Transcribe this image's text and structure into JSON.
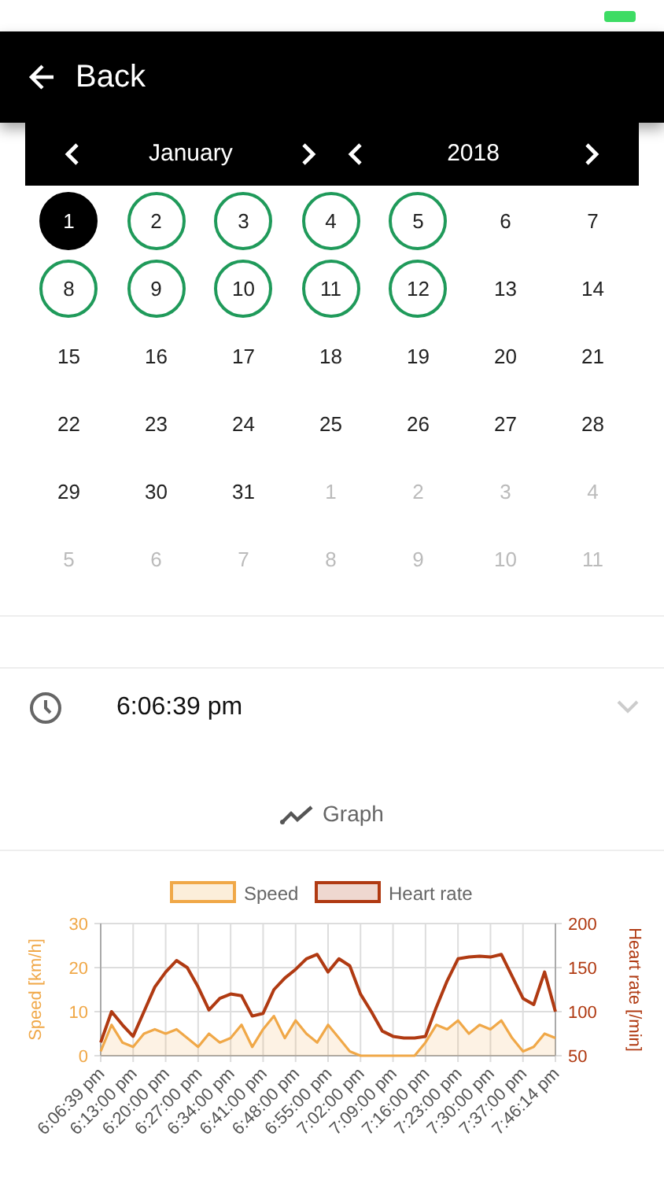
{
  "header": {
    "back_label": "Back"
  },
  "calendar": {
    "month": "January",
    "year": "2018",
    "weeks": [
      [
        {
          "label": "1",
          "selected": true,
          "marked": false,
          "outside": false
        },
        {
          "label": "2",
          "selected": false,
          "marked": true,
          "outside": false
        },
        {
          "label": "3",
          "selected": false,
          "marked": true,
          "outside": false
        },
        {
          "label": "4",
          "selected": false,
          "marked": true,
          "outside": false
        },
        {
          "label": "5",
          "selected": false,
          "marked": true,
          "outside": false
        },
        {
          "label": "6",
          "selected": false,
          "marked": false,
          "outside": false
        },
        {
          "label": "7",
          "selected": false,
          "marked": false,
          "outside": false
        }
      ],
      [
        {
          "label": "8",
          "selected": false,
          "marked": true,
          "outside": false
        },
        {
          "label": "9",
          "selected": false,
          "marked": true,
          "outside": false
        },
        {
          "label": "10",
          "selected": false,
          "marked": true,
          "outside": false
        },
        {
          "label": "11",
          "selected": false,
          "marked": true,
          "outside": false
        },
        {
          "label": "12",
          "selected": false,
          "marked": true,
          "outside": false
        },
        {
          "label": "13",
          "selected": false,
          "marked": false,
          "outside": false
        },
        {
          "label": "14",
          "selected": false,
          "marked": false,
          "outside": false
        }
      ],
      [
        {
          "label": "15",
          "selected": false,
          "marked": false,
          "outside": false
        },
        {
          "label": "16",
          "selected": false,
          "marked": false,
          "outside": false
        },
        {
          "label": "17",
          "selected": false,
          "marked": false,
          "outside": false
        },
        {
          "label": "18",
          "selected": false,
          "marked": false,
          "outside": false
        },
        {
          "label": "19",
          "selected": false,
          "marked": false,
          "outside": false
        },
        {
          "label": "20",
          "selected": false,
          "marked": false,
          "outside": false
        },
        {
          "label": "21",
          "selected": false,
          "marked": false,
          "outside": false
        }
      ],
      [
        {
          "label": "22",
          "selected": false,
          "marked": false,
          "outside": false
        },
        {
          "label": "23",
          "selected": false,
          "marked": false,
          "outside": false
        },
        {
          "label": "24",
          "selected": false,
          "marked": false,
          "outside": false
        },
        {
          "label": "25",
          "selected": false,
          "marked": false,
          "outside": false
        },
        {
          "label": "26",
          "selected": false,
          "marked": false,
          "outside": false
        },
        {
          "label": "27",
          "selected": false,
          "marked": false,
          "outside": false
        },
        {
          "label": "28",
          "selected": false,
          "marked": false,
          "outside": false
        }
      ],
      [
        {
          "label": "29",
          "selected": false,
          "marked": false,
          "outside": false
        },
        {
          "label": "30",
          "selected": false,
          "marked": false,
          "outside": false
        },
        {
          "label": "31",
          "selected": false,
          "marked": false,
          "outside": false
        },
        {
          "label": "1",
          "selected": false,
          "marked": false,
          "outside": true
        },
        {
          "label": "2",
          "selected": false,
          "marked": false,
          "outside": true
        },
        {
          "label": "3",
          "selected": false,
          "marked": false,
          "outside": true
        },
        {
          "label": "4",
          "selected": false,
          "marked": false,
          "outside": true
        }
      ],
      [
        {
          "label": "5",
          "selected": false,
          "marked": false,
          "outside": true
        },
        {
          "label": "6",
          "selected": false,
          "marked": false,
          "outside": true
        },
        {
          "label": "7",
          "selected": false,
          "marked": false,
          "outside": true
        },
        {
          "label": "8",
          "selected": false,
          "marked": false,
          "outside": true
        },
        {
          "label": "9",
          "selected": false,
          "marked": false,
          "outside": true
        },
        {
          "label": "10",
          "selected": false,
          "marked": false,
          "outside": true
        },
        {
          "label": "11",
          "selected": false,
          "marked": false,
          "outside": true
        }
      ]
    ]
  },
  "session": {
    "time": "6:06:39 pm",
    "expanded": false
  },
  "graph_button": {
    "label": "Graph"
  },
  "chart_data": {
    "type": "area",
    "ylabel": "Speed [km/h]",
    "y2label": "Heart rate [/min]",
    "categories": [
      "6:06:39 pm",
      null,
      null,
      "6:13:00 pm",
      null,
      null,
      "6:20:00 pm",
      null,
      null,
      "6:27:00 pm",
      null,
      null,
      "6:34:00 pm",
      null,
      null,
      "6:41:00 pm",
      null,
      null,
      "6:48:00 pm",
      null,
      null,
      "6:55:00 pm",
      null,
      null,
      "7:02:00 pm",
      null,
      null,
      "7:09:00 pm",
      null,
      null,
      "7:16:00 pm",
      null,
      null,
      "7:23:00 pm",
      null,
      null,
      "7:30:00 pm",
      null,
      null,
      "7:37:00 pm",
      null,
      null,
      "7:46:14 pm"
    ],
    "series": [
      {
        "name": "Speed",
        "color": "#f0a848",
        "values": [
          1,
          7,
          3,
          2,
          5,
          6,
          5,
          6,
          4,
          2,
          5,
          3,
          4,
          7,
          2,
          6,
          9,
          4,
          8,
          5,
          3,
          7,
          4,
          1,
          0,
          0,
          0,
          0,
          0,
          0,
          3,
          7,
          6,
          8,
          5,
          7,
          6,
          8,
          4,
          1,
          2,
          5,
          4
        ]
      },
      {
        "name": "Heart rate",
        "color": "#b03a12",
        "axis": "y2",
        "type": "line",
        "values": [
          65,
          100,
          85,
          72,
          100,
          128,
          145,
          158,
          150,
          128,
          102,
          115,
          120,
          118,
          95,
          98,
          125,
          138,
          148,
          160,
          165,
          145,
          160,
          152,
          120,
          100,
          78,
          72,
          70,
          70,
          72,
          105,
          135,
          160,
          162,
          163,
          162,
          165,
          140,
          115,
          108,
          145,
          100
        ]
      }
    ],
    "grid": true,
    "legend": "top",
    "ylim": [
      0,
      30
    ],
    "y2lim": [
      50,
      200
    ],
    "yticks": [
      0,
      10,
      20,
      30
    ],
    "y2ticks": [
      50,
      100,
      150,
      200
    ]
  }
}
